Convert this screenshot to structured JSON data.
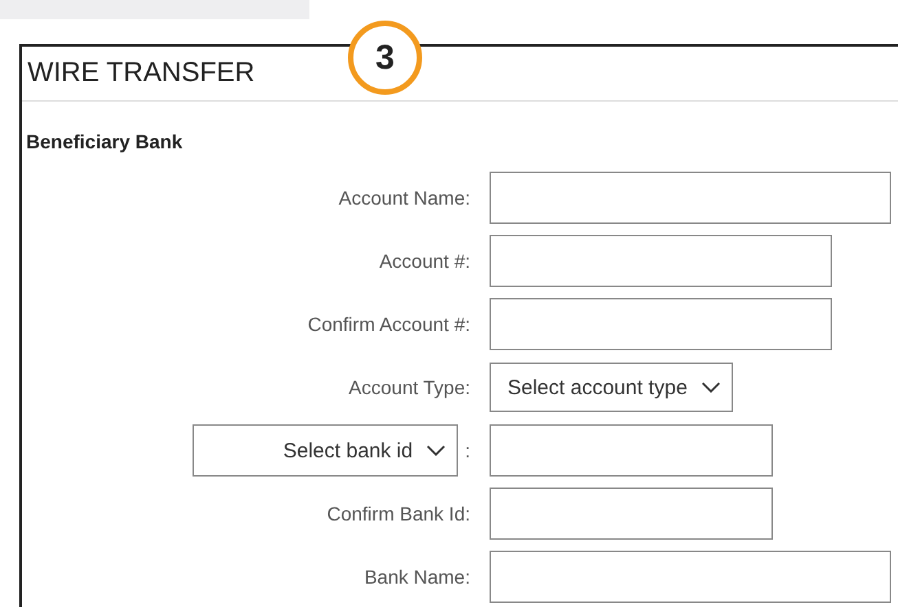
{
  "step_badge": "3",
  "panel": {
    "title": "WIRE TRANSFER",
    "section": "Beneficiary Bank",
    "rows": [
      {
        "kind": "text",
        "label": "Account Name:"
      },
      {
        "kind": "text",
        "label": "Account #:"
      },
      {
        "kind": "text",
        "label": "Confirm Account #:"
      },
      {
        "kind": "select",
        "label": "Account Type:",
        "select": "Select account type"
      },
      {
        "kind": "select_label",
        "select": "Select bank id",
        "label": ":"
      },
      {
        "kind": "text",
        "label": "Confirm Bank Id:"
      },
      {
        "kind": "text",
        "label": "Bank Name:"
      }
    ]
  }
}
